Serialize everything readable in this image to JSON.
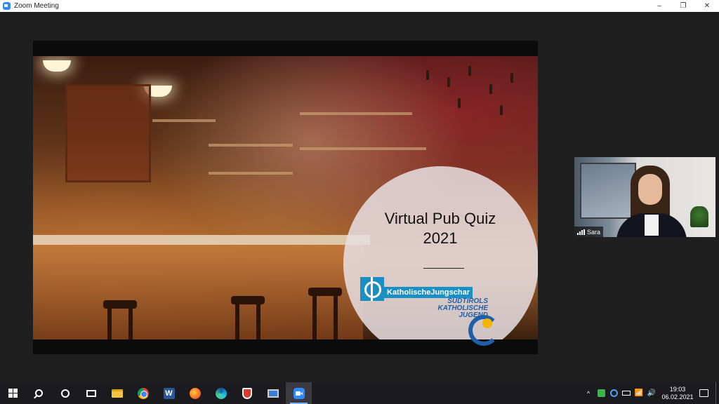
{
  "window": {
    "title": "Zoom Meeting",
    "controls": {
      "minimize": "–",
      "restore": "❐",
      "close": "✕"
    }
  },
  "slide": {
    "title_line1": "Virtual Pub Quiz",
    "title_line2": "2021",
    "logo_katholische": "KatholischeJungschar",
    "logo_skj_line1": "SÜDTIROLS",
    "logo_skj_line2": "KATHOLISCHE",
    "logo_skj_line3": "JUGEND"
  },
  "self_video": {
    "name": "Sara",
    "signal_icon": "signal-bars-icon"
  },
  "taskbar": {
    "items": [
      "windows-start-icon",
      "search-icon",
      "cortana-icon",
      "task-view-icon",
      "file-explorer-icon",
      "chrome-icon",
      "word-icon",
      "firefox-icon",
      "edge-icon",
      "shield-app-icon",
      "remote-desktop-icon",
      "zoom-icon"
    ],
    "word_letter": "W",
    "tray": {
      "chevron": "^",
      "clock_time": "19:03",
      "clock_date": "06.02.2021",
      "volume": "🔊",
      "wifi": "📶"
    }
  },
  "colors": {
    "zoom_blue": "#2d8cff",
    "taskbar_bg": "#1b1b1f",
    "meeting_bg": "#1f1f1f",
    "kj_blue": "#1a8fc4",
    "skj_blue": "#1f5fa8",
    "skj_yellow": "#f4b400"
  }
}
